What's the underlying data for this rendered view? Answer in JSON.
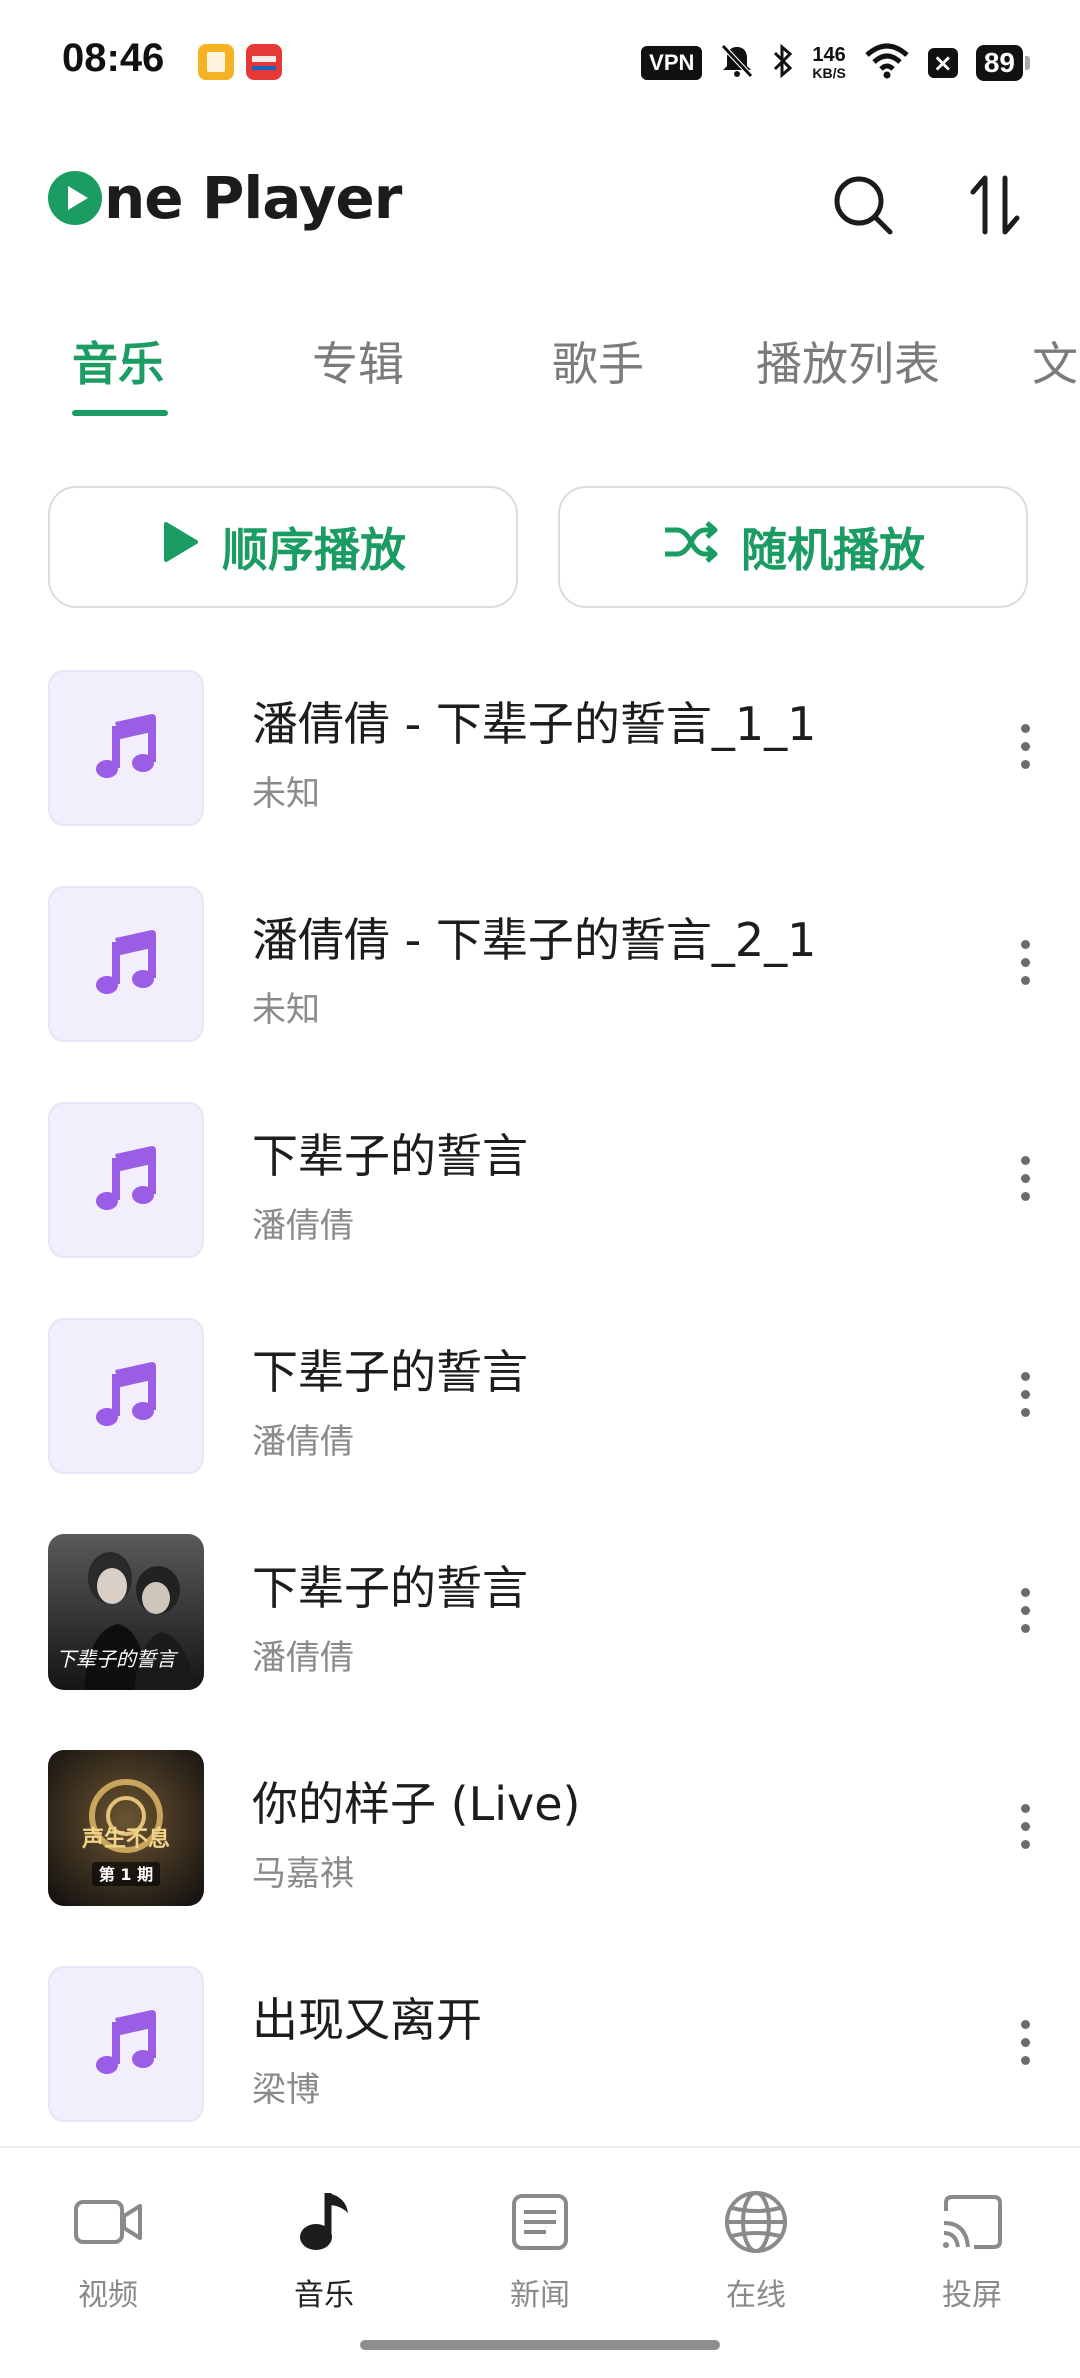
{
  "status_bar": {
    "time": "08:46",
    "vpn": "VPN",
    "speed_value": "146",
    "speed_unit": "KB/S",
    "battery": "89"
  },
  "header": {
    "logo_text": "ne Player",
    "search_icon": "search-icon",
    "sort_icon": "sort-icon"
  },
  "tabs": [
    {
      "label": "音乐",
      "active": true
    },
    {
      "label": "专辑"
    },
    {
      "label": "歌手"
    },
    {
      "label": "播放列表"
    },
    {
      "label": "文"
    }
  ],
  "actions": {
    "sequential_play": "顺序播放",
    "shuffle_play": "随机播放"
  },
  "songs": [
    {
      "title": "潘倩倩 - 下辈子的誓言_1_1",
      "artist": "未知",
      "cover": "music-note-icon"
    },
    {
      "title": "潘倩倩 - 下辈子的誓言_2_1",
      "artist": "未知",
      "cover": "music-note-icon"
    },
    {
      "title": "下辈子的誓言",
      "artist": "潘倩倩",
      "cover": "music-note-icon"
    },
    {
      "title": "下辈子的誓言",
      "artist": "潘倩倩",
      "cover": "music-note-icon"
    },
    {
      "title": "下辈子的誓言",
      "artist": "潘倩倩",
      "cover": "album-art",
      "cover_text": "下辈子的誓言"
    },
    {
      "title": "你的样子 (Live)",
      "artist": "马嘉祺",
      "cover": "album-art",
      "cover_text": "声生不息",
      "cover_sub": "第 1 期"
    },
    {
      "title": "出现又离开",
      "artist": "梁博",
      "cover": "music-note-icon"
    }
  ],
  "nav": [
    {
      "label": "视频",
      "icon": "video-icon"
    },
    {
      "label": "音乐",
      "icon": "music-icon",
      "active": true
    },
    {
      "label": "新闻",
      "icon": "news-icon"
    },
    {
      "label": "在线",
      "icon": "globe-icon"
    },
    {
      "label": "投屏",
      "icon": "cast-icon"
    }
  ],
  "colors": {
    "accent": "#1a9c63",
    "note": "#9b5de5",
    "cover_bg": "#f3eefc"
  }
}
